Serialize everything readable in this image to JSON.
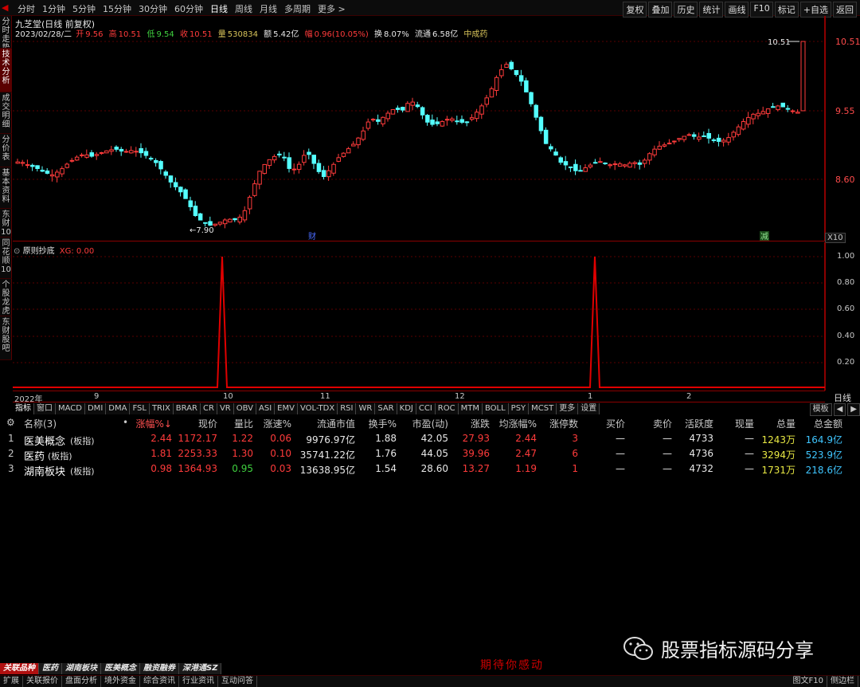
{
  "topbar": {
    "periods": [
      "分时",
      "1分钟",
      "5分钟",
      "15分钟",
      "30分钟",
      "60分钟",
      "日线",
      "周线",
      "月线",
      "多周期",
      "更多 >"
    ],
    "active_period": "日线",
    "right_tools": [
      "复权",
      "叠加",
      "历史",
      "统计",
      "画线",
      "F10",
      "标记",
      "+自选",
      "返回"
    ]
  },
  "sidebar": [
    "分时走势",
    "技术分析",
    "成交明细",
    "分价表",
    "基本资料",
    "东财10",
    "同花顺10",
    "个股龙虎",
    "东财股吧"
  ],
  "sidebar_active": "技术分析",
  "stock": {
    "title": "九芝堂(日线 前复权)",
    "date": "2023/02/28/二",
    "open_label": "开",
    "open": "9.56",
    "high_label": "高",
    "high": "10.51",
    "low_label": "低",
    "low": "9.54",
    "close_label": "收",
    "close": "10.51",
    "vol_label": "量",
    "vol": "530834",
    "amount_label": "额",
    "amount": "5.42亿",
    "chg_label": "幅",
    "chg": "0.96(10.05%)",
    "turnover_label": "换",
    "turnover": "8.07%",
    "float_label": "流通",
    "float": "6.58亿",
    "industry": "中成药"
  },
  "main_axis": {
    "y_ticks": [
      "10.51",
      "9.55",
      "8.60"
    ],
    "high_marker": "10.51",
    "low_marker": "←7.90",
    "badge_fin": "财",
    "badge_jian": "减",
    "x10": "X10"
  },
  "indicator": {
    "title": "原则抄底",
    "xg_label": "XG: 0.00",
    "y_ticks": [
      "1.00",
      "0.80",
      "0.60",
      "0.40",
      "0.20"
    ]
  },
  "time_axis": {
    "labels": [
      "2022年",
      "9",
      "10",
      "11",
      "12",
      "1",
      "2"
    ],
    "right": "日线"
  },
  "ind_tabs": [
    "指标",
    "窗口",
    "MACD",
    "DMI",
    "DMA",
    "FSL",
    "TRIX",
    "BRAR",
    "CR",
    "VR",
    "OBV",
    "ASI",
    "EMV",
    "VOL-TDX",
    "RSI",
    "WR",
    "SAR",
    "KDJ",
    "CCI",
    "ROC",
    "MTM",
    "BOLL",
    "PSY",
    "MCST",
    "更多",
    "设置"
  ],
  "ind_right": [
    "模板",
    "◀",
    "▶"
  ],
  "table": {
    "headers": [
      "名称(3)",
      "•",
      "涨幅%↓",
      "现价",
      "量比",
      "涨速%",
      "流通市值",
      "换手%",
      "市盈(动)",
      "涨跌",
      "均涨幅%",
      "涨停数",
      "买价",
      "卖价",
      "活跃度",
      "现量",
      "总量",
      "总金额"
    ],
    "rows": [
      {
        "idx": "1",
        "name": "医美概念",
        "tag": "(板指)",
        "chg": "2.44",
        "price": "1172.17",
        "vr": "1.22",
        "speed": "0.06",
        "mcap": "9976.97亿",
        "turn": "1.88",
        "pe": "42.05",
        "diff": "27.93",
        "avg": "2.44",
        "limit": "3",
        "bid": "—",
        "ask": "—",
        "act": "4733",
        "cur": "—",
        "vol": "1243万",
        "amt": "164.9亿"
      },
      {
        "idx": "2",
        "name": "医药",
        "tag": "(板指)",
        "chg": "1.81",
        "price": "2253.33",
        "vr": "1.30",
        "speed": "0.10",
        "mcap": "35741.22亿",
        "turn": "1.76",
        "pe": "44.05",
        "diff": "39.96",
        "avg": "2.47",
        "limit": "6",
        "bid": "—",
        "ask": "—",
        "act": "4736",
        "cur": "—",
        "vol": "3294万",
        "amt": "523.9亿"
      },
      {
        "idx": "3",
        "name": "湖南板块",
        "tag": "(板指)",
        "chg": "0.98",
        "price": "1364.93",
        "vr": "0.95",
        "speed": "0.03",
        "mcap": "13638.95亿",
        "turn": "1.54",
        "pe": "28.60",
        "diff": "13.27",
        "avg": "1.19",
        "limit": "1",
        "bid": "—",
        "ask": "—",
        "act": "4732",
        "cur": "—",
        "vol": "1731万",
        "amt": "218.6亿"
      }
    ]
  },
  "bottom_tabs": [
    "关联品种",
    "医药",
    "湖南板块",
    "医美概念",
    "融资融券",
    "深港通SZ"
  ],
  "status_bar": [
    "扩展",
    "关联报价",
    "盘面分析",
    "境外资金",
    "综合资讯",
    "行业资讯",
    "互动问答"
  ],
  "status_right": [
    "图文F10",
    "侧边栏"
  ],
  "watermark": "股票指标源码分享",
  "slogan": "期待你感动",
  "colors": {
    "up": "#ff3b3b",
    "down": "#54ffff",
    "grid": "#8b0000",
    "signal": "#e00000"
  }
}
